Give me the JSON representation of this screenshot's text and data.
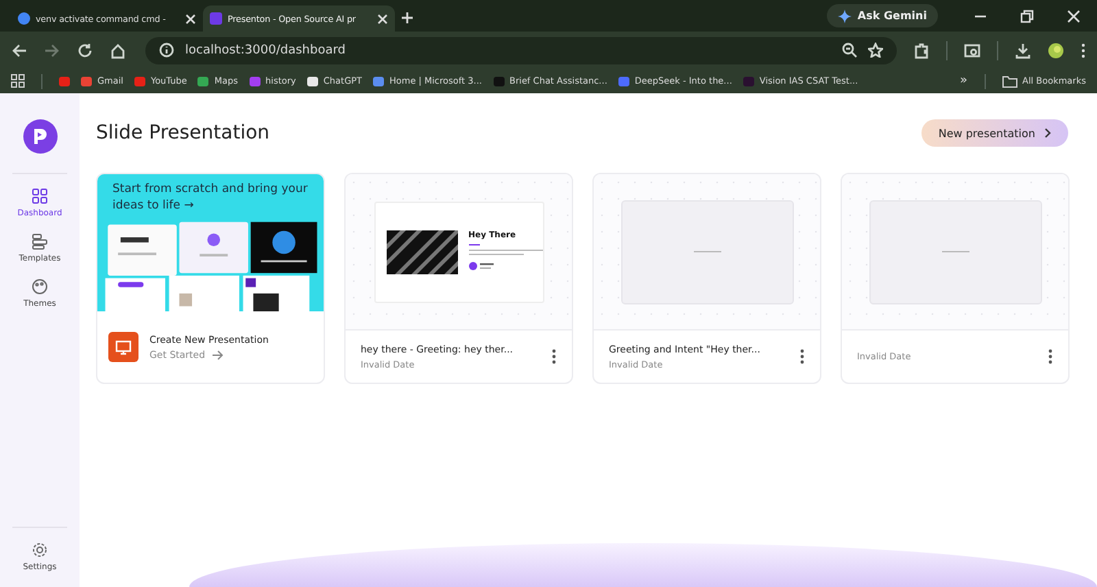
{
  "browser": {
    "tabs": [
      {
        "title": "venv activate command cmd -",
        "selected": false,
        "color": "#4285f4"
      },
      {
        "title": "Presenton - Open Source AI pr",
        "selected": true,
        "color": "#6d3ae6"
      }
    ],
    "address": "localhost:3000/dashboard",
    "gemini_button": "Ask Gemini",
    "bookmarks": [
      {
        "color": "#e62117"
      },
      {
        "label": "Gmail",
        "color": "#ea4335"
      },
      {
        "label": "YouTube",
        "color": "#e62117"
      },
      {
        "label": "Maps",
        "color": "#34a853"
      },
      {
        "label": "history",
        "color": "#a23ef0"
      },
      {
        "label": "ChatGPT",
        "color": "#e8e8e8"
      },
      {
        "label": "Home | Microsoft 3...",
        "color": "#5b8def"
      },
      {
        "label": "Brief Chat Assistanc...",
        "color": "#111111"
      },
      {
        "label": "DeepSeek - Into the...",
        "color": "#4d6bfe"
      },
      {
        "label": "Vision IAS CSAT Test...",
        "color": "#2a1030"
      }
    ],
    "more_bookmarks": "»",
    "all_bookmarks": "All Bookmarks"
  },
  "sidebar": {
    "items": [
      {
        "label": "Dashboard",
        "selected": true
      },
      {
        "label": "Templates",
        "selected": false
      },
      {
        "label": "Themes",
        "selected": false
      }
    ],
    "bottom_item": {
      "label": "Settings",
      "selected": false
    }
  },
  "page": {
    "title": "Slide Presentation",
    "new_button": "New presentation",
    "start_card": {
      "headline": "Start from scratch and bring your ideas to life →",
      "title": "Create New Presentation",
      "action": "Get Started"
    },
    "presentations": [
      {
        "title": "hey there - Greeting: hey ther...",
        "date": "Invalid Date",
        "thumbnail": {
          "kind": "slide",
          "heading": "Hey There"
        }
      },
      {
        "title": "Greeting and Intent \"Hey ther...",
        "date": "Invalid Date",
        "thumbnail": {
          "kind": "blank"
        }
      },
      {
        "date": "Invalid Date",
        "thumbnail": {
          "kind": "blank"
        }
      }
    ]
  }
}
